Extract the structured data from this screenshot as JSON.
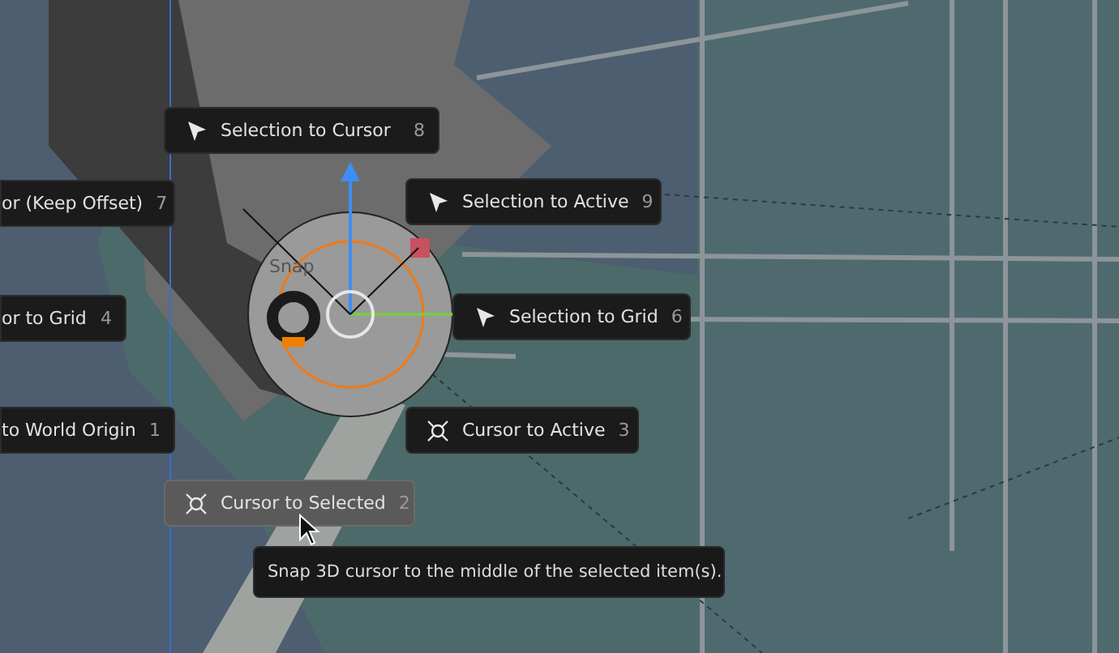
{
  "pie_menu": {
    "title": "Snap",
    "items": [
      {
        "label": "Selection to Cursor",
        "shortcut": "8",
        "kind": "selection",
        "selected": false
      },
      {
        "label": "or (Keep Offset)",
        "shortcut": "7",
        "kind": "clipped",
        "selected": false
      },
      {
        "label": "Selection to Active",
        "shortcut": "9",
        "kind": "selection",
        "selected": false
      },
      {
        "label": "or to Grid",
        "shortcut": "4",
        "kind": "clipped",
        "selected": false
      },
      {
        "label": "Selection to Grid",
        "shortcut": "6",
        "kind": "selection",
        "selected": false
      },
      {
        "label": "to World Origin",
        "shortcut": "1",
        "kind": "clipped",
        "selected": false
      },
      {
        "label": "Cursor to Active",
        "shortcut": "3",
        "kind": "cursor",
        "selected": false
      },
      {
        "label": "Cursor to Selected",
        "shortcut": "2",
        "kind": "cursor",
        "selected": true
      }
    ]
  },
  "tooltip": {
    "text": "Snap 3D cursor to the middle of the selected item(s)."
  }
}
